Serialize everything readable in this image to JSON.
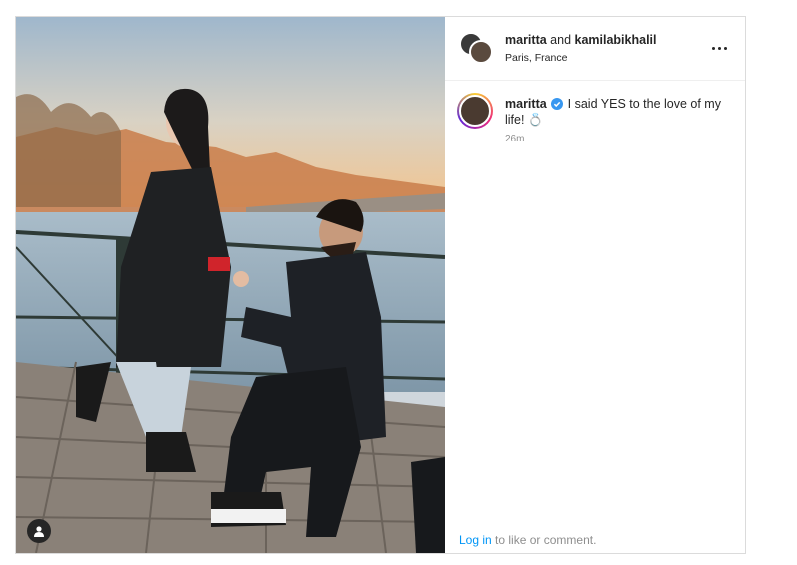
{
  "post": {
    "header": {
      "user1": "maritta",
      "connector": " and ",
      "user2": "kamilabikhalil",
      "location": "Paris, France"
    },
    "caption": {
      "username": "maritta",
      "text": " I said YES to the love of my life! 💍",
      "time": "26m"
    },
    "footer": {
      "login_label": "Log in",
      "rest": " to like or comment."
    }
  },
  "icons": [
    "user-tag-icon",
    "more-options-icon",
    "verified-badge-icon"
  ],
  "colors": {
    "link": "#0095f6",
    "verified": "#3897f0",
    "border": "#dbdbdb"
  }
}
